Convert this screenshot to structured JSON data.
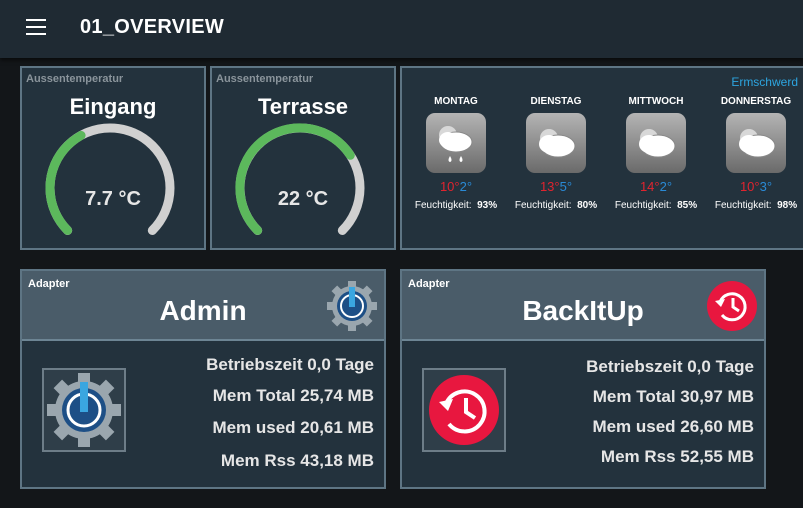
{
  "app": {
    "title": "01_OVERVIEW"
  },
  "gauges": [
    {
      "caption": "Aussentemperatur",
      "title": "Eingang",
      "value": 7.7,
      "display": "7.7 °C"
    },
    {
      "caption": "Aussentemperatur",
      "title": "Terrasse",
      "value": 22,
      "display": "22 °C"
    }
  ],
  "weather": {
    "link": "Ermschwerd",
    "humidity_label": "Feuchtigkeit:",
    "days": [
      {
        "name": "MONTAG",
        "high": "10°",
        "low": "2°",
        "humidity": "93%",
        "icon": "rain-cloud-icon"
      },
      {
        "name": "DIENSTAG",
        "high": "13°",
        "low": "5°",
        "humidity": "80%",
        "icon": "partly-cloudy-icon"
      },
      {
        "name": "MITTWOCH",
        "high": "14°",
        "low": "2°",
        "humidity": "85%",
        "icon": "partly-cloudy-icon"
      },
      {
        "name": "DONNERSTAG",
        "high": "10°",
        "low": "3°",
        "humidity": "98%",
        "icon": "partly-cloudy-icon"
      }
    ]
  },
  "adapters": [
    {
      "caption": "Adapter",
      "name": "Admin",
      "icon": "admin-gear-icon",
      "uptime": "Betriebszeit 0,0 Tage",
      "mem_total": "Mem Total 25,74 MB",
      "mem_used": "Mem used 20,61 MB",
      "mem_rss": "Mem Rss 43,18 MB"
    },
    {
      "caption": "Adapter",
      "name": "BackItUp",
      "icon": "backup-clock-icon",
      "uptime": "Betriebszeit 0,0 Tage",
      "mem_total": "Mem Total 30,97 MB",
      "mem_used": "Mem used 26,60 MB",
      "mem_rss": "Mem Rss 52,55 MB"
    }
  ],
  "colors": {
    "gauge_fill": "#5cb85c",
    "gauge_track": "#d0d0d0",
    "accent_link": "#2da5e0",
    "temp_high": "#e0242f",
    "temp_low": "#2a8ad6",
    "backup_red": "#e8173f"
  }
}
